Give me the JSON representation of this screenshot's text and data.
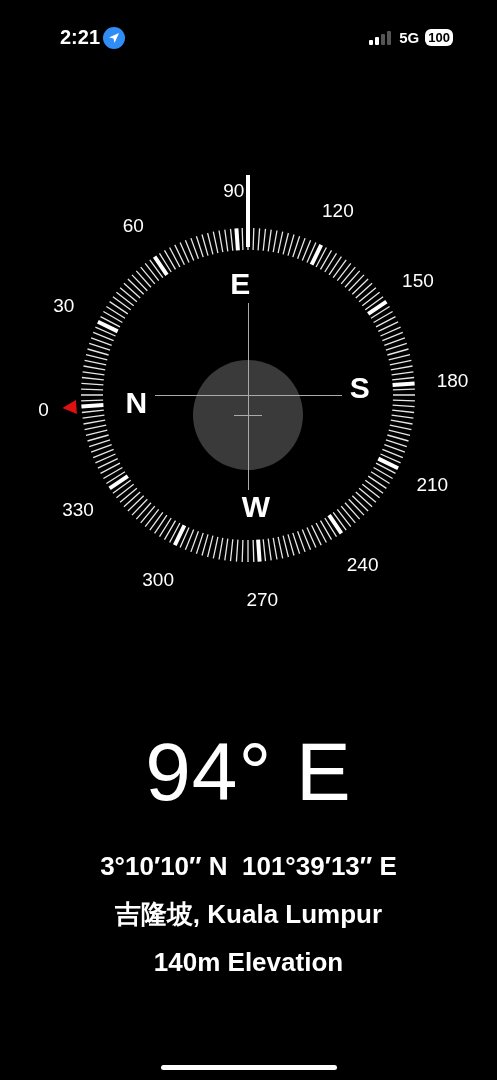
{
  "status_bar": {
    "time": "2:21",
    "network": "5G",
    "battery": "100"
  },
  "compass": {
    "degree_labels": [
      "0",
      "30",
      "60",
      "90",
      "120",
      "150",
      "180",
      "210",
      "240",
      "270",
      "300",
      "330"
    ],
    "cardinals": [
      "N",
      "E",
      "S",
      "W"
    ]
  },
  "heading": "94° E",
  "coordinates": "3°10′10″ N  101°39′13″ E",
  "location": "吉隆坡, Kuala Lumpur",
  "elevation": "140m Elevation"
}
